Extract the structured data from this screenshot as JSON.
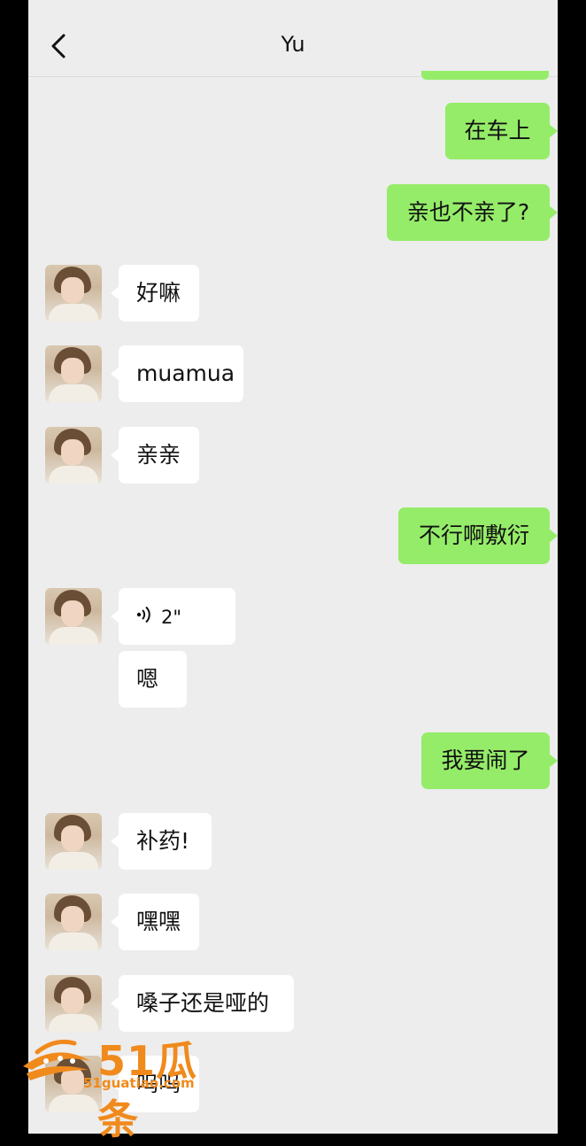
{
  "header": {
    "title": "Yu"
  },
  "messages": [
    {
      "side": "out",
      "text": "在车上"
    },
    {
      "side": "out",
      "text": "亲也不亲了?"
    },
    {
      "side": "in",
      "text": "好嘛"
    },
    {
      "side": "in",
      "text": "muamua"
    },
    {
      "side": "in",
      "text": "亲亲"
    },
    {
      "side": "out",
      "text": "不行啊敷衍"
    },
    {
      "side": "in",
      "type": "voice",
      "text": "2\""
    },
    {
      "side": "in",
      "text": "嗯"
    },
    {
      "side": "out",
      "text": "我要闹了"
    },
    {
      "side": "in",
      "text": "补药!"
    },
    {
      "side": "in",
      "text": "嘿嘿"
    },
    {
      "side": "in",
      "text": "嗓子还是哑的"
    },
    {
      "side": "in",
      "text": "呜呜"
    }
  ],
  "watermark": {
    "brand": "51瓜条",
    "url": "51guatiao.com"
  },
  "colors": {
    "background": "#ededed",
    "outgoing_bubble": "#95ec69",
    "incoming_bubble": "#ffffff",
    "watermark": "#f08a1c"
  },
  "icons": {
    "back": "chevron-left-icon",
    "voice": "voice-waves-icon"
  }
}
